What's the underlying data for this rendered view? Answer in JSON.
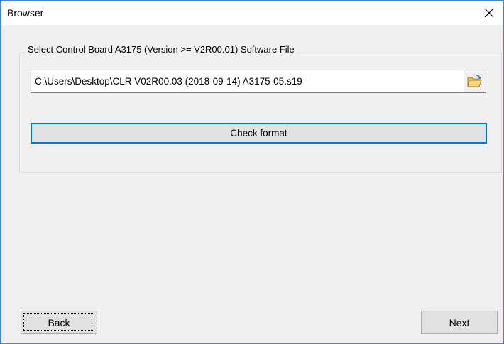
{
  "window": {
    "title": "Browser"
  },
  "file_group": {
    "label": "Select Control Board A3175 (Version >= V2R00.01) Software File",
    "path_value": "C:\\Users\\Desktop\\CLR V02R00.03 (2018-09-14) A3175-05.s19",
    "browse_icon": "folder-open-icon",
    "check_label": "Check format"
  },
  "footer": {
    "back_label": "Back",
    "next_label": "Next"
  },
  "colors": {
    "accent": "#0078d7",
    "window_bg": "#f0f0f0",
    "button_bg": "#e1e1e1"
  }
}
